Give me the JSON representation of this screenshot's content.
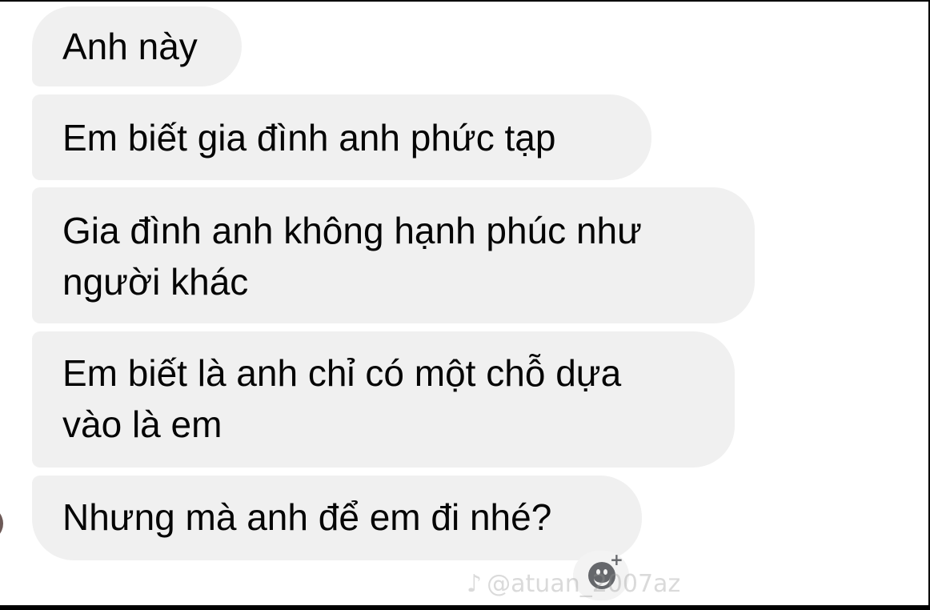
{
  "messages": [
    {
      "lines": [
        "Anh này"
      ]
    },
    {
      "lines": [
        "Em biết gia đình anh phức tạp"
      ]
    },
    {
      "lines": [
        "Gia đình anh không hạnh phúc như",
        "người khác"
      ]
    },
    {
      "lines": [
        "Em biết là anh chỉ có một chỗ dựa",
        "vào là em"
      ]
    },
    {
      "lines": [
        "Nhưng mà anh để em đi nhé?"
      ]
    }
  ],
  "reaction_button": {
    "icon": "add-reaction-icon",
    "plus": "+"
  },
  "watermark": {
    "icon": "tiktok-logo-icon",
    "handle": "@atuan_2007az"
  },
  "colors": {
    "bubble_bg": "#f0f0f0",
    "text": "#050505",
    "icon": "#65676b"
  }
}
